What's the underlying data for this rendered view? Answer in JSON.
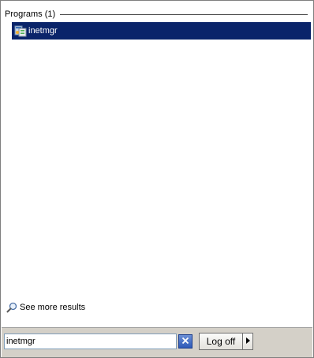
{
  "results": {
    "section_header": "Programs (1)",
    "items": [
      {
        "label": "inetmgr",
        "icon": "iis-manager-icon"
      }
    ],
    "see_more_label": "See more results"
  },
  "search": {
    "value": "inetmgr",
    "clear_icon": "close-icon"
  },
  "power": {
    "logoff_label": "Log off",
    "arrow_icon": "arrow-right-icon"
  },
  "colors": {
    "selection": "#0a246a",
    "bottom_bar": "#d4d0c8"
  }
}
